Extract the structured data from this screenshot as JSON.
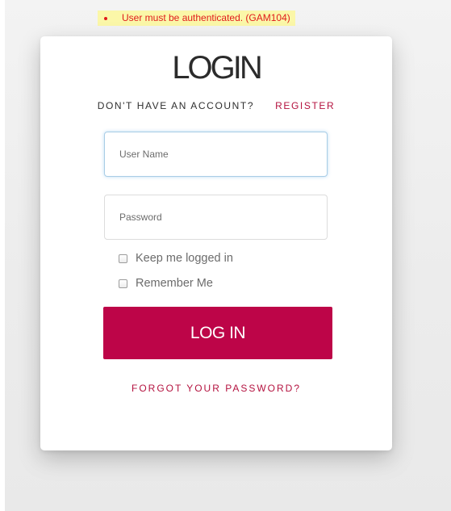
{
  "error": {
    "message": "User must be authenticated. (GAM104)"
  },
  "login": {
    "title": "LOGIN",
    "no_account_text": "DON'T HAVE AN ACCOUNT?",
    "register_link": "REGISTER",
    "username": {
      "placeholder": "User Name",
      "value": ""
    },
    "password": {
      "placeholder": "Password",
      "value": ""
    },
    "keep_logged_in": {
      "label": "Keep me logged in",
      "checked": false
    },
    "remember_me": {
      "label": "Remember Me",
      "checked": false
    },
    "submit_label": "LOG IN",
    "forgot_link": "FORGOT YOUR PASSWORD?"
  },
  "colors": {
    "accent": "#bd0548",
    "link": "#b4123f",
    "error_text": "#e01b1b",
    "error_background": "#fbf7a8"
  }
}
